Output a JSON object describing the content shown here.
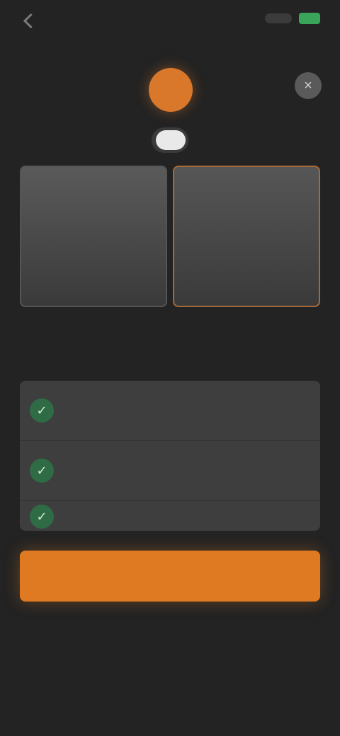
{
  "status_bar": {
    "back_label": "",
    "battery_color": "#3aa45a"
  },
  "header": {
    "logo_icon": "brand-logo",
    "close_icon_glyph": "×"
  },
  "billing_toggle": {
    "left_label": "",
    "right_label": ""
  },
  "plans": [
    {
      "title": "",
      "subtitle": ""
    },
    {
      "title": "",
      "subtitle": "",
      "selected": true
    }
  ],
  "plans_note": "",
  "features_section": {
    "title": "",
    "items": [
      {
        "icon": "check-icon",
        "text": ""
      },
      {
        "icon": "check-icon",
        "text": ""
      },
      {
        "icon": "check-icon",
        "text": ""
      }
    ]
  },
  "cta": {
    "label": "",
    "color": "#e07a22"
  },
  "footer": {
    "restore_label": "",
    "terms_text": "",
    "links_text": ""
  }
}
